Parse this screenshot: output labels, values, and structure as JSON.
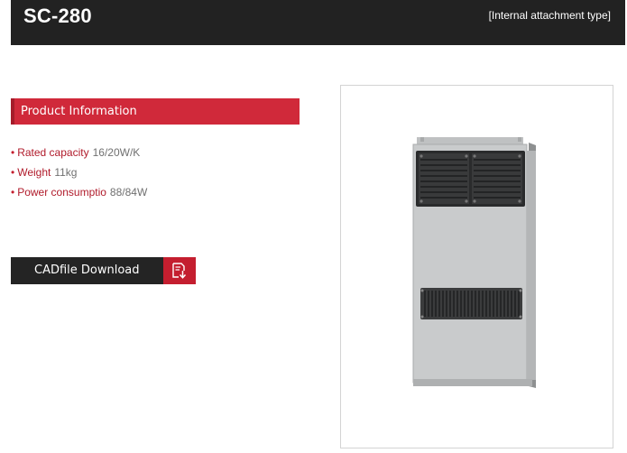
{
  "header": {
    "title": "SC-280",
    "subtitle": "[Internal attachment type]"
  },
  "product_info": {
    "section_label": "Product Information",
    "specs": [
      {
        "label": "Rated capacity",
        "value": "16/20W/K"
      },
      {
        "label": "Weight",
        "value": "11kg"
      },
      {
        "label": "Power consumptio",
        "value": "88/84W"
      }
    ]
  },
  "cad": {
    "button_label": "CADfile Download",
    "icon": "download-file-icon"
  },
  "product_image": {
    "icon": "cabinet-cooler-unit-image"
  },
  "colors": {
    "header_bg": "#222222",
    "accent_red": "#d0293a",
    "button_bg": "#242424"
  }
}
